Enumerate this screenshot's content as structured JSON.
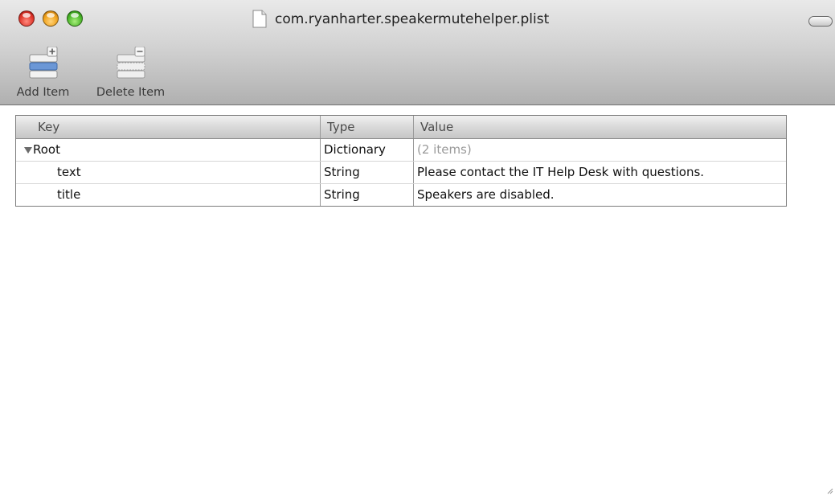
{
  "window": {
    "title": "com.ryanharter.speakermutehelper.plist"
  },
  "toolbar": {
    "add_label": "Add Item",
    "delete_label": "Delete Item"
  },
  "table": {
    "columns": [
      "Key",
      "Type",
      "Value"
    ],
    "rows": [
      {
        "key": "Root",
        "type": "Dictionary",
        "value": "(2 items)",
        "expanded": true
      },
      {
        "key": "text",
        "type": "String",
        "value": "Please contact the IT Help Desk with questions."
      },
      {
        "key": "title",
        "type": "String",
        "value": "Speakers are disabled."
      }
    ]
  },
  "icons": {
    "close": "close-icon",
    "minimize": "minimize-icon",
    "zoom": "zoom-icon",
    "document": "document-icon",
    "add": "add-item-icon",
    "delete": "delete-item-icon",
    "disclosure": "disclosure-triangle-icon",
    "toolbar_toggle": "toolbar-toggle-icon"
  },
  "colors": {
    "close": "#e0362b",
    "minimize": "#f0a21c",
    "zoom": "#4cb72a",
    "add_icon": "#6b97d6"
  }
}
